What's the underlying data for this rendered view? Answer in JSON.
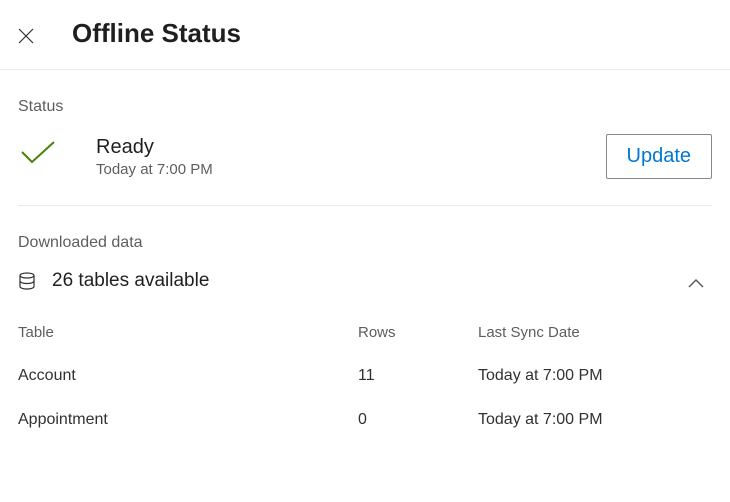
{
  "header": {
    "title": "Offline Status"
  },
  "status": {
    "section_label": "Status",
    "state": "Ready",
    "timestamp": "Today at 7:00 PM",
    "update_label": "Update"
  },
  "downloaded": {
    "section_label": "Downloaded data",
    "summary": "26 tables available",
    "columns": {
      "table": "Table",
      "rows": "Rows",
      "last_sync": "Last Sync Date"
    },
    "rows": [
      {
        "name": "Account",
        "count": "11",
        "last_sync": "Today at 7:00 PM"
      },
      {
        "name": "Appointment",
        "count": "0",
        "last_sync": "Today at 7:00 PM"
      }
    ]
  },
  "colors": {
    "accent": "#0078d4",
    "success": "#498205"
  }
}
